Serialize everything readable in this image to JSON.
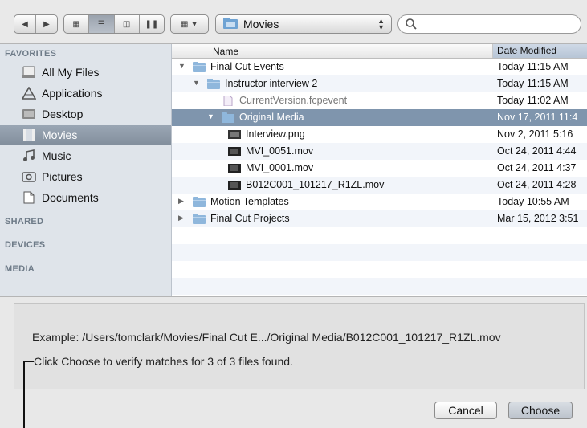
{
  "toolbar": {
    "path_label": "Movies",
    "search_placeholder": ""
  },
  "sidebar": {
    "favorites_heading": "FAVORITES",
    "items": [
      {
        "label": "All My Files",
        "icon": "all-files-icon"
      },
      {
        "label": "Applications",
        "icon": "applications-icon"
      },
      {
        "label": "Desktop",
        "icon": "desktop-icon"
      },
      {
        "label": "Movies",
        "icon": "movies-icon",
        "selected": true
      },
      {
        "label": "Music",
        "icon": "music-icon"
      },
      {
        "label": "Pictures",
        "icon": "pictures-icon"
      },
      {
        "label": "Documents",
        "icon": "documents-icon"
      }
    ],
    "shared_heading": "SHARED",
    "devices_heading": "DEVICES",
    "media_heading": "MEDIA"
  },
  "list": {
    "col_name": "Name",
    "col_date": "Date Modified",
    "rows": [
      {
        "name": "Final Cut Events",
        "date": "Today 11:15 AM",
        "depth": 0,
        "expanded": true,
        "type": "folder"
      },
      {
        "name": "Instructor interview 2",
        "date": "Today 11:15 AM",
        "depth": 1,
        "expanded": true,
        "type": "folder"
      },
      {
        "name": "CurrentVersion.fcpevent",
        "date": "Today 11:02 AM",
        "depth": 2,
        "type": "doc",
        "dim": true
      },
      {
        "name": "Original Media",
        "date": "Nov 17, 2011 11:4",
        "depth": 2,
        "expanded": true,
        "type": "folder",
        "selected": true
      },
      {
        "name": "Interview.png",
        "date": "Nov 2, 2011 5:16",
        "depth": 3,
        "type": "image"
      },
      {
        "name": "MVI_0051.mov",
        "date": "Oct 24, 2011 4:44",
        "depth": 3,
        "type": "movie"
      },
      {
        "name": "MVI_0001.mov",
        "date": "Oct 24, 2011 4:37",
        "depth": 3,
        "type": "movie"
      },
      {
        "name": "B012C001_101217_R1ZL.mov",
        "date": "Oct 24, 2011 4:28",
        "depth": 3,
        "type": "movie"
      },
      {
        "name": "Motion Templates",
        "date": "Today 10:55 AM",
        "depth": 0,
        "expanded": false,
        "type": "folder"
      },
      {
        "name": "Final Cut Projects",
        "date": "Mar 15, 2012 3:51",
        "depth": 0,
        "expanded": false,
        "type": "folder"
      }
    ]
  },
  "panel": {
    "example": "Example: /Users/tomclark/Movies/Final Cut E.../Original Media/B012C001_101217_R1ZL.mov",
    "status": "Click Choose to verify matches for 3 of 3 files found."
  },
  "buttons": {
    "cancel": "Cancel",
    "choose": "Choose"
  },
  "colors": {
    "selection": "#7f95ad",
    "sidebar_bg": "#dfe4ea",
    "folder": "#8fb7dc"
  }
}
